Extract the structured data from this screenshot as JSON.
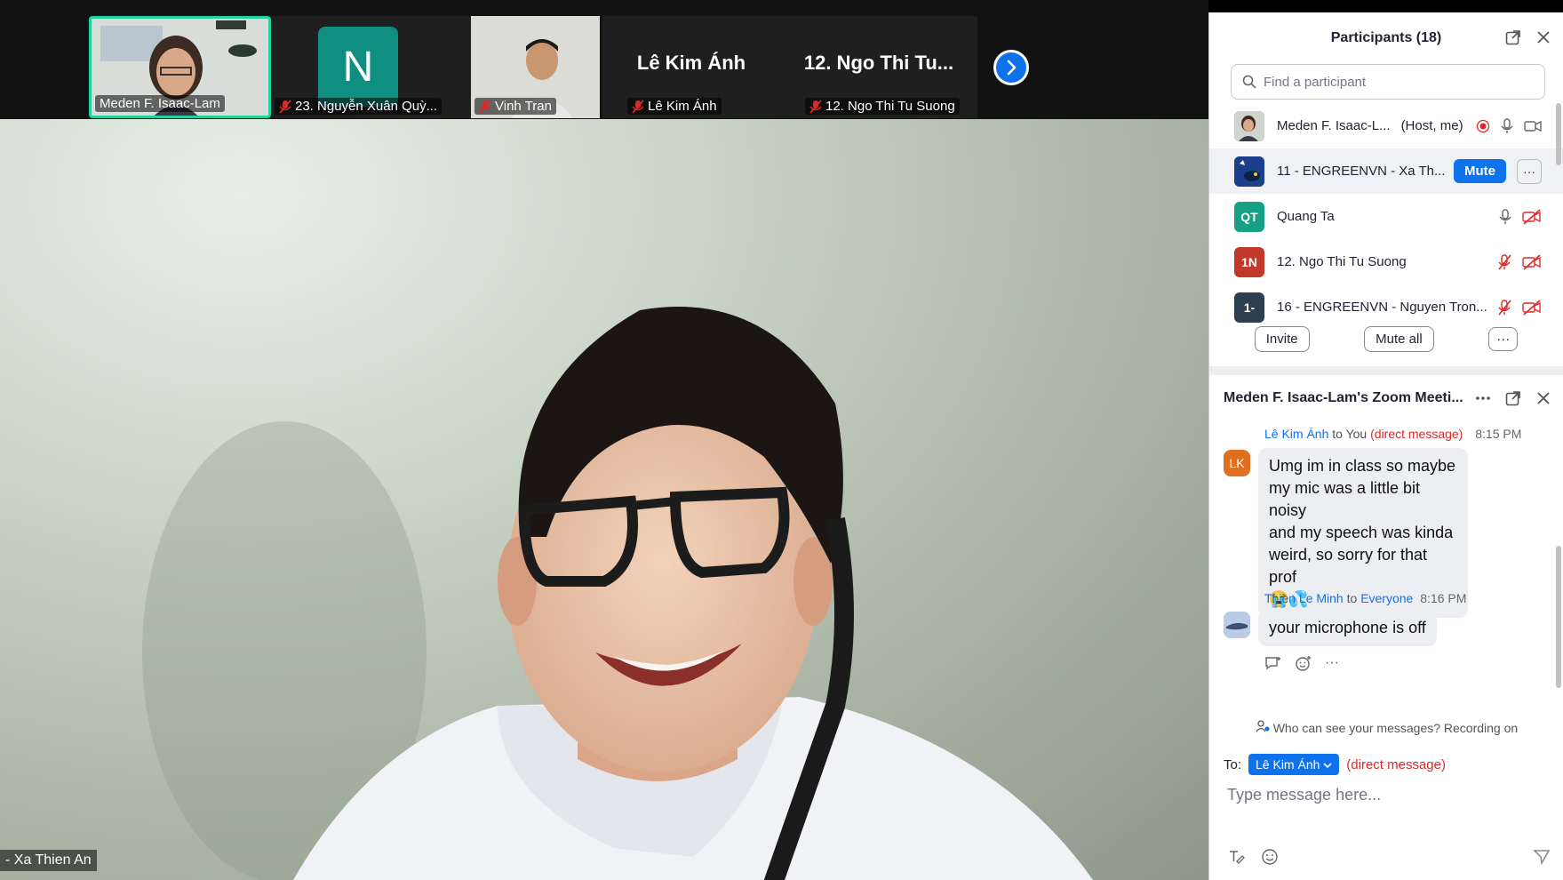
{
  "thumbnails": [
    {
      "name": "Meden F. Isaac-Lam",
      "muted": false,
      "active": true
    },
    {
      "name": "23. Nguyễn Xuân Quỳ...",
      "muted": true,
      "initial": "N"
    },
    {
      "name": "Vinh Tran",
      "muted": true
    },
    {
      "name": "Lê Kim Ánh",
      "muted": true,
      "big_name": "Lê Kim Ánh"
    },
    {
      "name": "12. Ngo Thi Tu Suong",
      "muted": true,
      "big_name": "12. Ngo Thi Tu..."
    }
  ],
  "main_video": {
    "name_label": "- Xa Thien An"
  },
  "participants": {
    "title": "Participants (18)",
    "search_placeholder": "Find a participant",
    "list": [
      {
        "name": "Meden F. Isaac-L...",
        "tag": "(Host, me)",
        "avatar": "",
        "avatar_color": "#6b5a4a"
      },
      {
        "name": "11 - ENGREENVN - Xa Th...",
        "avatar": "",
        "avatar_color": "#1b3f8c",
        "mute_label": "Mute",
        "more": "···"
      },
      {
        "name": "Quang Ta",
        "avatar": "QT",
        "avatar_color": "#16a085"
      },
      {
        "name": "12. Ngo Thi Tu Suong",
        "avatar": "1N",
        "avatar_color": "#c0392b"
      },
      {
        "name": "16 - ENGREENVN - Nguyen Tron...",
        "avatar": "1-",
        "avatar_color": "#2c3e50"
      }
    ],
    "invite_label": "Invite",
    "mute_all_label": "Mute all",
    "more_label": "···"
  },
  "chat": {
    "title": "Meden F. Isaac-Lam's Zoom Meeti...",
    "messages": [
      {
        "sender": "Lê Kim Ánh",
        "to_word": " to ",
        "recipient": "You",
        "dm": "(direct message)",
        "time": "8:15 PM",
        "avatar": "LK",
        "avatar_color": "#e07020",
        "lines": [
          "Umg im in class so maybe",
          "my mic was a little bit noisy",
          "and my speech was kinda",
          "weird, so sorry for that prof",
          "😭💦"
        ]
      },
      {
        "sender": "Thien Le Minh",
        "to_word": " to ",
        "recipient": "Everyone",
        "time": "8:16 PM",
        "avatar_color": "#7a9cc6",
        "text": "your microphone is off"
      }
    ],
    "reactions_more": "···",
    "visibility_note": "Who can see your messages? Recording on",
    "to_label": "To:",
    "to_value": "Lê Kim Ánh",
    "to_dm": "(direct message)",
    "compose_placeholder": "Type message here..."
  }
}
